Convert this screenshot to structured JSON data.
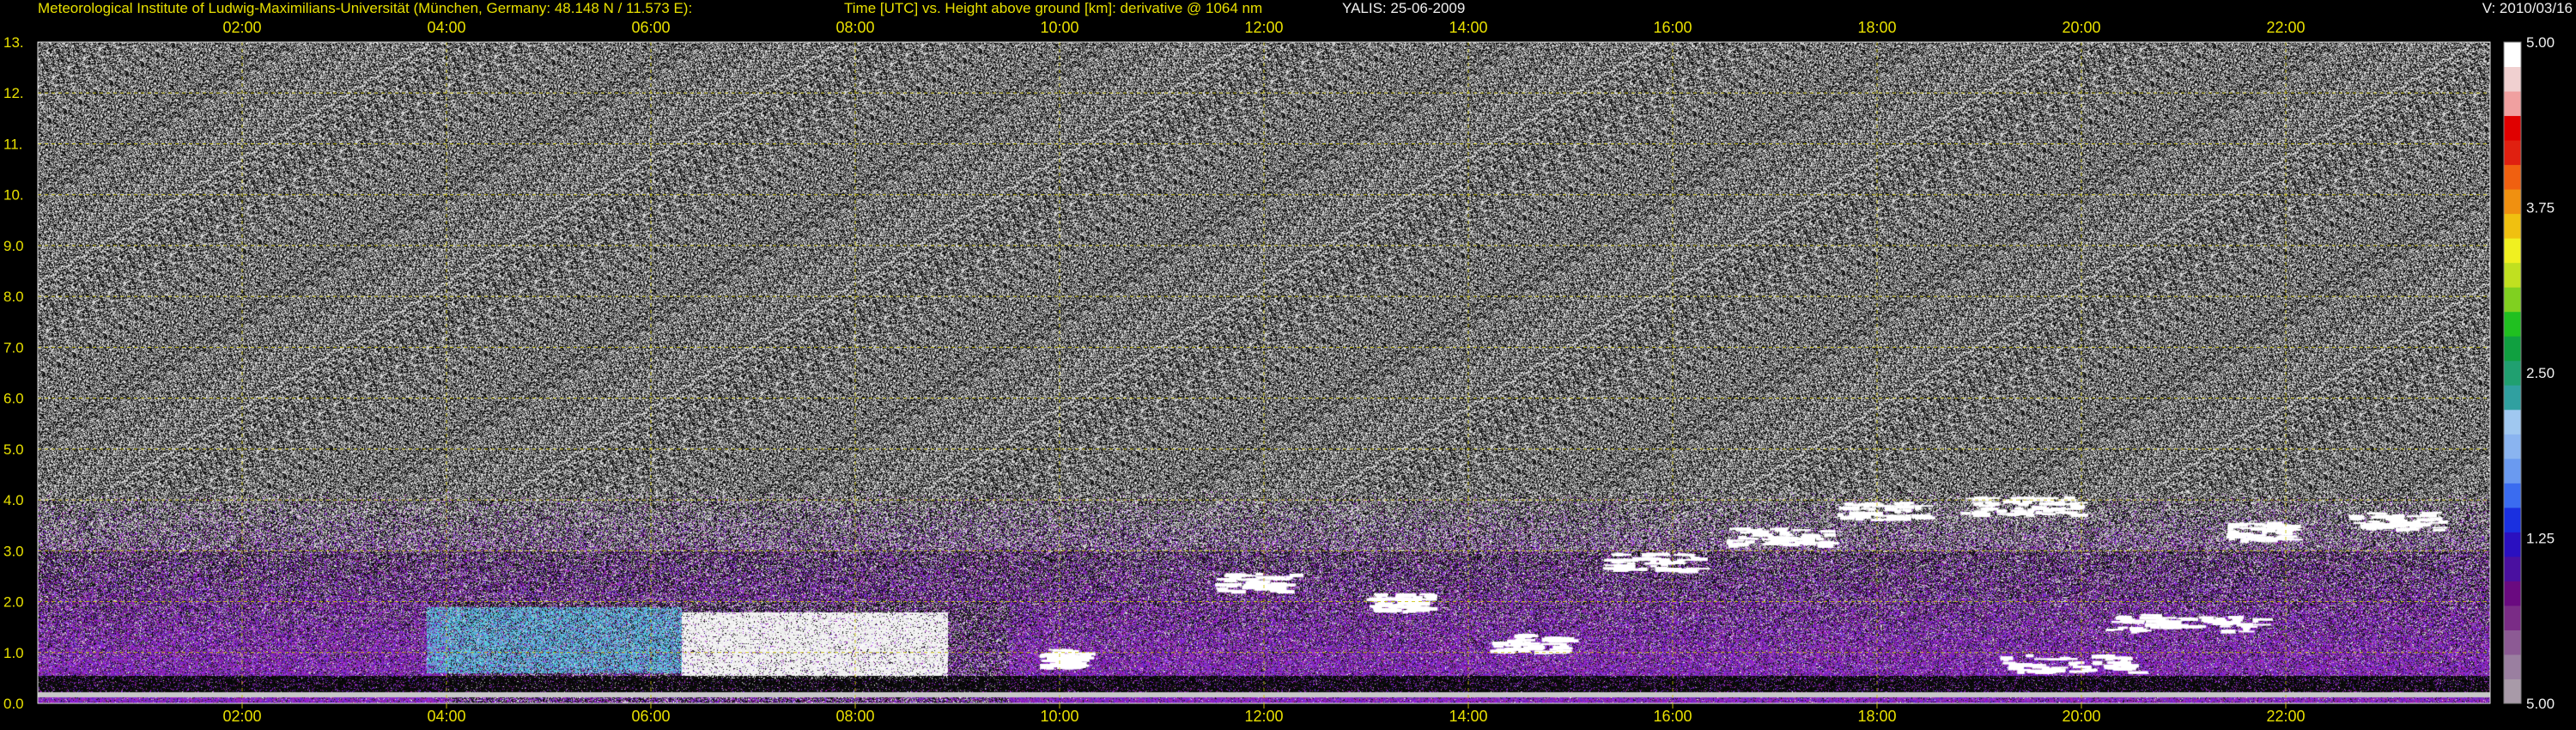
{
  "header": {
    "institute": "Meteorological Institute of Ludwig-Maximilians-Universität (München, Germany: 48.148 N / 11.573 E):",
    "axes_description": "Time [UTC] vs. Height above ground [km]: derivative @ 1064 nm",
    "instrument_date": "YALIS: 25-06-2009",
    "version": "V: 2010/03/16"
  },
  "colors": {
    "label_yellow": "#e8e000",
    "label_white": "#f0f0f0",
    "grid_yellow": "#c8c000",
    "background": "#000000"
  },
  "chart_data": {
    "type": "heatmap",
    "title": "Time [UTC] vs. Height above ground [km]: derivative @ 1064 nm",
    "xlabel": "Time [UTC]",
    "ylabel": "Height above ground [km]",
    "xlim": [
      "00:00",
      "24:00"
    ],
    "ylim": [
      0.0,
      13.0
    ],
    "x_ticks": [
      "02:00",
      "04:00",
      "06:00",
      "08:00",
      "10:00",
      "12:00",
      "14:00",
      "16:00",
      "18:00",
      "20:00",
      "22:00"
    ],
    "y_ticks": [
      "0.0",
      "1.0",
      "2.0",
      "3.0",
      "4.0",
      "5.0",
      "6.0",
      "7.0",
      "8.0",
      "9.0",
      "10.",
      "11.",
      "12.",
      "13."
    ],
    "colorbar": {
      "tick_labels": [
        "5.00",
        "1.25",
        "2.50",
        "3.75",
        "5.00"
      ],
      "colors": [
        "#a89aa8",
        "#9a7fa0",
        "#8c5a94",
        "#7a2c86",
        "#6a0a80",
        "#4a10a0",
        "#2a10c0",
        "#1a30e0",
        "#3a6cf0",
        "#6a9af0",
        "#8ab4f0",
        "#a0c8f0",
        "#30a0a0",
        "#20a070",
        "#10a040",
        "#20c020",
        "#80d020",
        "#c0e020",
        "#f0f020",
        "#f0c010",
        "#f09010",
        "#f06010",
        "#e02010",
        "#e00000",
        "#f0a0a0",
        "#f0d0d0",
        "#ffffff"
      ]
    },
    "grid": true
  }
}
